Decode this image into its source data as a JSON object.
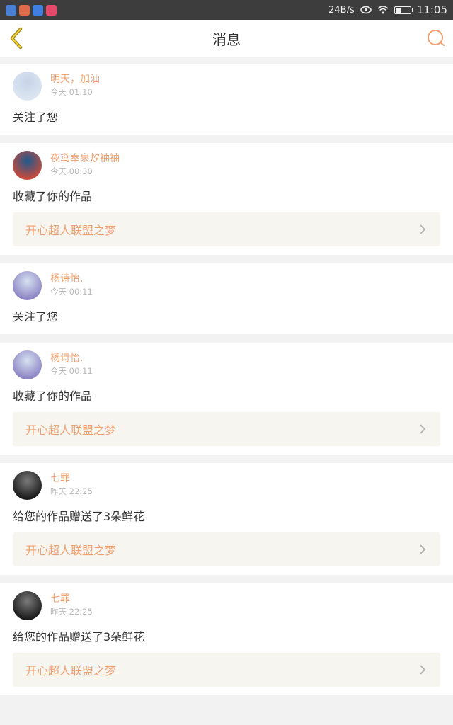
{
  "status_bar": {
    "speed": "24B/s",
    "time": "11:05",
    "battery_level": 0.35
  },
  "navbar": {
    "title": "消息",
    "back_icon": "back-chevron-icon",
    "search_icon": "search-icon"
  },
  "notifications": [
    {
      "username": "明天，加油",
      "time": "今天 01:10",
      "message": "关注了您",
      "work_title": "",
      "avatar_colors": [
        "#dce6f2",
        "#c7d4e8"
      ]
    },
    {
      "username": "夜鸢奉泉㶤䄂䄂",
      "time": "今天 00:30",
      "message": "收藏了你的作品",
      "work_title": "开心超人联盟之梦",
      "avatar_colors": [
        "#c84a3a",
        "#1d5a8f"
      ]
    },
    {
      "username": "杨诗怡.",
      "time": "今天 00:11",
      "message": "关注了您",
      "work_title": "",
      "avatar_colors": [
        "#8c83c4",
        "#d6e2f0"
      ]
    },
    {
      "username": "杨诗怡.",
      "time": "今天 00:11",
      "message": "收藏了你的作品",
      "work_title": "开心超人联盟之梦",
      "avatar_colors": [
        "#8c83c4",
        "#d6e2f0"
      ]
    },
    {
      "username": "七罪",
      "time": "昨天 22:25",
      "message": "给您的作品赠送了3朵鲜花",
      "work_title": "开心超人联盟之梦",
      "avatar_colors": [
        "#1a1a1a",
        "#7a7a7a"
      ]
    },
    {
      "username": "七罪",
      "time": "昨天 22:25",
      "message": "给您的作品赠送了3朵鲜花",
      "work_title": "开心超人联盟之梦",
      "avatar_colors": [
        "#1a1a1a",
        "#7a7a7a"
      ]
    }
  ],
  "colors": {
    "accent": "#f0a070",
    "card_bg": "#ffffff",
    "work_bg": "#f7f5ef",
    "page_bg": "#f2f2f2"
  }
}
